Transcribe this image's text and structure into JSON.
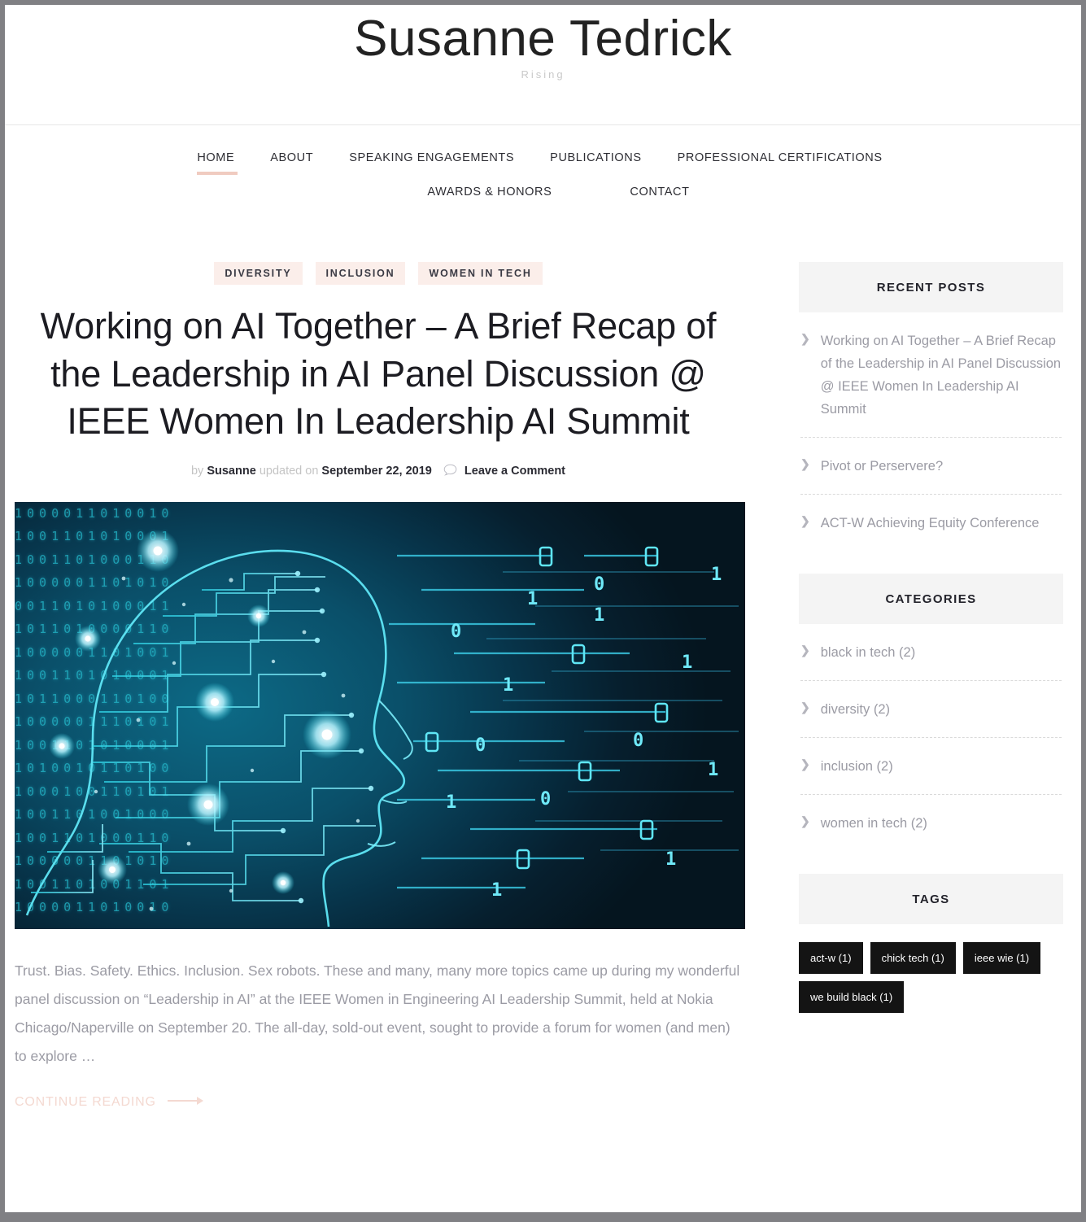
{
  "site": {
    "title": "Susanne Tedrick",
    "tagline": "Rising"
  },
  "nav": {
    "row1": [
      {
        "label": "HOME",
        "active": true
      },
      {
        "label": "ABOUT",
        "active": false
      },
      {
        "label": "SPEAKING ENGAGEMENTS",
        "active": false
      },
      {
        "label": "PUBLICATIONS",
        "active": false
      },
      {
        "label": "PROFESSIONAL CERTIFICATIONS",
        "active": false
      }
    ],
    "row2": [
      {
        "label": "AWARDS & HONORS",
        "active": false
      },
      {
        "label": "CONTACT",
        "active": false
      }
    ]
  },
  "post": {
    "badges": [
      "DIVERSITY",
      "INCLUSION",
      "WOMEN IN TECH"
    ],
    "title": "Working on AI Together – A Brief Recap of the Leadership in AI Panel Discussion @ IEEE Women In Leadership AI Summit",
    "byline": {
      "by_label": "by",
      "author": "Susanne",
      "updated_label": "updated on",
      "date": "September 22, 2019",
      "comment_link": "Leave a Comment",
      "comment_icon": "speech-bubble-icon"
    },
    "featured_image": {
      "alt": "AI circuit-board human head profile with binary code streaming",
      "binary_rows": [
        "1000011010010",
        "1001101010001",
        "1001101000110",
        "1000001101010",
        "0011010100011",
        "1011010000110",
        "1000001101001",
        "1001101010001",
        "1011000110100",
        "1000001110101",
        "1001101010001",
        "1010010110100",
        "1000100110101",
        "1001101001000",
        "1001101000110",
        "1000001101010",
        "1001101001101",
        "1000011010010"
      ]
    },
    "excerpt": "Trust. Bias. Safety. Ethics. Inclusion. Sex robots. These and many, many more topics came up during my wonderful panel discussion on “Leadership in AI” at the IEEE Women in Engineering AI Leadership Summit, held at Nokia Chicago/Naperville on September 20. The all-day, sold-out event, sought to provide a forum for women (and men) to explore …",
    "continue_label": "CONTINUE READING"
  },
  "sidebar": {
    "recent_posts": {
      "heading": "RECENT POSTS",
      "items": [
        "Working on AI Together – A Brief Recap of the Leadership in AI Panel Discussion @ IEEE Women In Leadership AI Summit",
        "Pivot or Perservere?",
        "ACT-W Achieving Equity Conference"
      ]
    },
    "categories": {
      "heading": "CATEGORIES",
      "items": [
        "black in tech (2)",
        "diversity (2)",
        "inclusion (2)",
        "women in tech (2)"
      ]
    },
    "tags": {
      "heading": "TAGS",
      "items": [
        "act-w (1)",
        "chick tech (1)",
        "ieee wie (1)",
        "we build black (1)"
      ]
    }
  },
  "colors": {
    "accent_pink": "#f0cbc0",
    "badge_bg": "#fbeeea",
    "widget_head_bg": "#f4f4f4",
    "tag_bg": "#141414",
    "muted_text": "#9b9ba4"
  }
}
